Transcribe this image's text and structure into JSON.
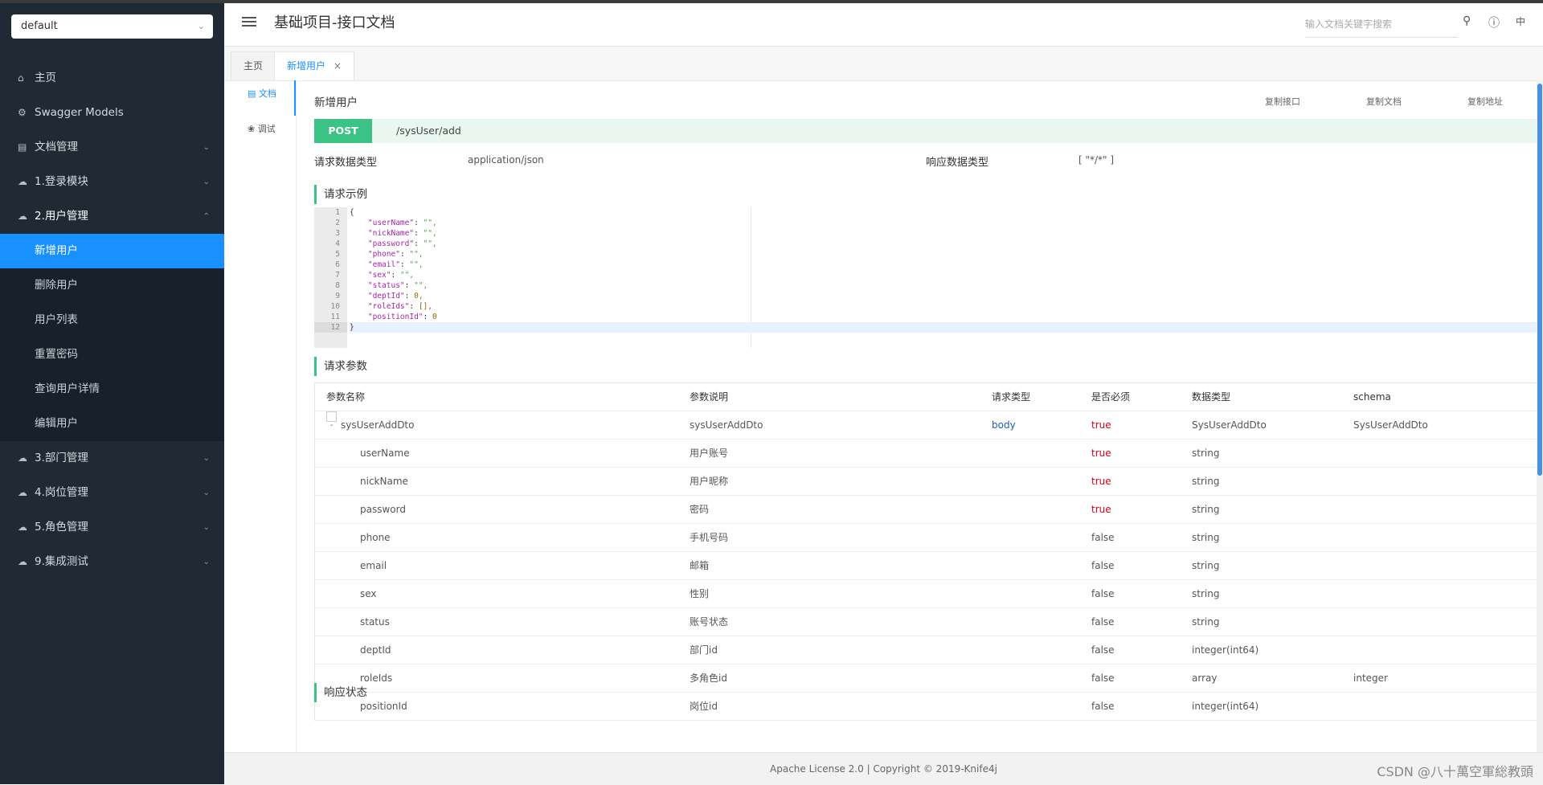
{
  "group_selector": {
    "value": "default"
  },
  "sidebar": {
    "items": [
      {
        "label": "主页",
        "icon": "home-icon"
      },
      {
        "label": "Swagger Models",
        "icon": "models-icon"
      },
      {
        "label": "文档管理",
        "icon": "doc-icon"
      },
      {
        "label": "1.登录模块",
        "icon": "cloud-icon"
      },
      {
        "label": "2.用户管理",
        "icon": "cloud-icon"
      },
      {
        "label": "3.部门管理",
        "icon": "cloud-icon"
      },
      {
        "label": "4.岗位管理",
        "icon": "cloud-icon"
      },
      {
        "label": "5.角色管理",
        "icon": "cloud-icon"
      },
      {
        "label": "9.集成测试",
        "icon": "cloud-icon"
      }
    ],
    "sub_items": [
      "新增用户",
      "删除用户",
      "用户列表",
      "重置密码",
      "查询用户详情",
      "编辑用户"
    ]
  },
  "header": {
    "title": "基础项目-接口文档",
    "search_placeholder": "输入文档关键字搜索",
    "lang": "中"
  },
  "tabs": [
    {
      "label": "主页"
    },
    {
      "label": "新增用户"
    }
  ],
  "doc_nav": {
    "doc": "文档",
    "debug": "调试"
  },
  "api": {
    "title": "新增用户",
    "copy_api": "复制接口",
    "copy_doc": "复制文档",
    "copy_url": "复制地址",
    "method": "POST",
    "path": "/sysUser/add",
    "req_type_label": "请求数据类型",
    "req_type": "application/json",
    "resp_type_label": "响应数据类型",
    "resp_type": "[ \"*/*\" ]",
    "example_title": "请求示例",
    "params_title": "请求参数",
    "status_title": "响应状态"
  },
  "code_lines": [
    "{",
    "    \"userName\": \"\",",
    "    \"nickName\": \"\",",
    "    \"password\": \"\",",
    "    \"phone\": \"\",",
    "    \"email\": \"\",",
    "    \"sex\": \"\",",
    "    \"status\": \"\",",
    "    \"deptId\": 0,",
    "    \"roleIds\": [],",
    "    \"positionId\": 0",
    "}"
  ],
  "params": {
    "columns": [
      "参数名称",
      "参数说明",
      "请求类型",
      "是否必须",
      "数据类型",
      "schema"
    ],
    "parent": {
      "expander": "-",
      "name": "sysUserAddDto",
      "desc": "sysUserAddDto",
      "in": "body",
      "required": "true",
      "type": "SysUserAddDto",
      "schema": "SysUserAddDto"
    },
    "rows": [
      {
        "name": "userName",
        "desc": "用户账号",
        "required": "true",
        "type": "string",
        "schema": ""
      },
      {
        "name": "nickName",
        "desc": "用户昵称",
        "required": "true",
        "type": "string",
        "schema": ""
      },
      {
        "name": "password",
        "desc": "密码",
        "required": "true",
        "type": "string",
        "schema": ""
      },
      {
        "name": "phone",
        "desc": "手机号码",
        "required": "false",
        "type": "string",
        "schema": ""
      },
      {
        "name": "email",
        "desc": "邮箱",
        "required": "false",
        "type": "string",
        "schema": ""
      },
      {
        "name": "sex",
        "desc": "性别",
        "required": "false",
        "type": "string",
        "schema": ""
      },
      {
        "name": "status",
        "desc": "账号状态",
        "required": "false",
        "type": "string",
        "schema": ""
      },
      {
        "name": "deptId",
        "desc": "部门id",
        "required": "false",
        "type": "integer(int64)",
        "schema": ""
      },
      {
        "name": "roleIds",
        "desc": "多角色id",
        "required": "false",
        "type": "array",
        "schema": "integer"
      },
      {
        "name": "positionId",
        "desc": "岗位id",
        "required": "false",
        "type": "integer(int64)",
        "schema": ""
      }
    ]
  },
  "footer": {
    "text": "Apache License 2.0 | Copyright © 2019-Knife4j",
    "watermark": "CSDN @八十萬空軍総教頭"
  },
  "colors": {
    "accent": "#1890ff",
    "post": "#3bc285",
    "sidebar_bg": "#1f2a35",
    "required_true": "#d0021b"
  }
}
